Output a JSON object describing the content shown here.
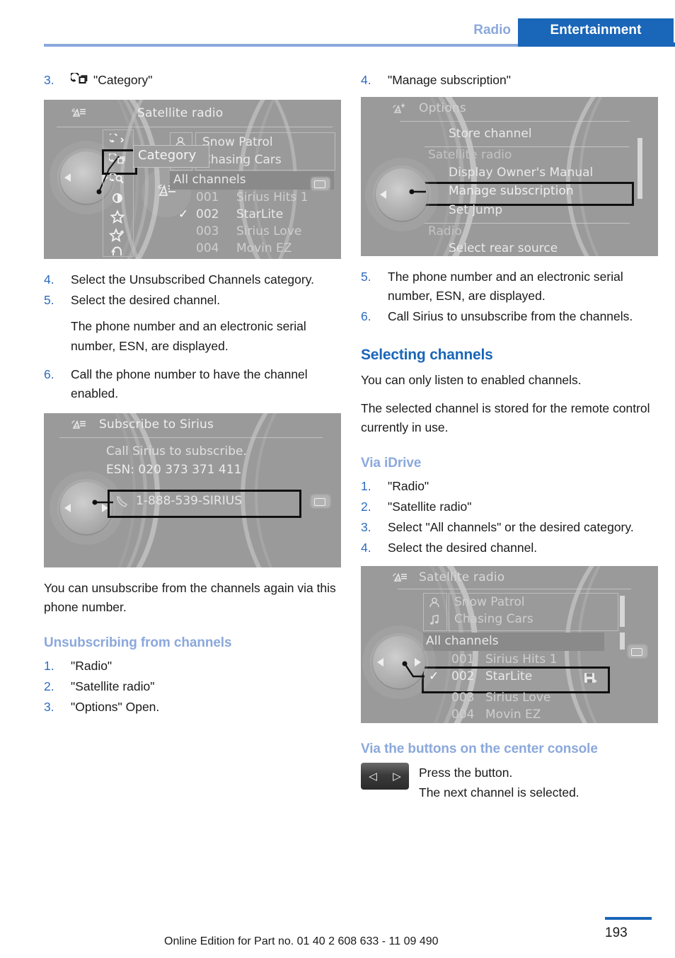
{
  "header": {
    "section": "Radio",
    "tab": "Entertainment",
    "accent_dark": "#1a66b8",
    "accent_light": "#8ba8dc"
  },
  "left_column": {
    "step3": {
      "num": "3.",
      "icon": "category-icon",
      "text": "\"Category\""
    },
    "shot1": {
      "name": "satellite-radio-category-screen",
      "title": "Satellite radio",
      "tooltip": "Category",
      "artist": "Snow Patrol",
      "track": "Chasing Cars",
      "band": "All channels",
      "channels": [
        {
          "check": "",
          "num": "001",
          "name": "Sirius Hits 1"
        },
        {
          "check": "✓",
          "num": "002",
          "name": "StarLite"
        },
        {
          "check": "",
          "num": "003",
          "name": "Sirius Love"
        },
        {
          "check": "",
          "num": "004",
          "name": "Movin EZ"
        }
      ]
    },
    "steps": [
      {
        "num": "4.",
        "text": "Select the Unsubscribed Channels category."
      },
      {
        "num": "5.",
        "text": "Select the desired channel."
      }
    ],
    "note1": "The phone number and an electronic serial number, ESN, are displayed.",
    "step6": {
      "num": "6.",
      "text": "Call the phone number to have the channel enabled."
    },
    "shot2": {
      "name": "subscribe-to-sirius-screen",
      "title": "Subscribe to Sirius",
      "line1": "Call Sirius to subscribe.",
      "line2": "ESN: 020 373 371 411",
      "phone": "1-888-539-SIRIUS"
    },
    "note2": "You can unsubscribe from the channels again via this phone number.",
    "subhead": "Unsubscribing from channels",
    "unsub_steps": [
      {
        "num": "1.",
        "text": "\"Radio\""
      },
      {
        "num": "2.",
        "text": "\"Satellite radio\""
      },
      {
        "num": "3.",
        "text": "\"Options\" Open."
      }
    ]
  },
  "right_column": {
    "step4": {
      "num": "4.",
      "text": "\"Manage subscription\""
    },
    "shot3": {
      "name": "options-menu-screen",
      "title": "Options",
      "items": [
        {
          "label": "Store channel",
          "group": false,
          "highlight": false
        },
        {
          "label": "Satellite radio",
          "group": true,
          "highlight": false
        },
        {
          "label": "Display Owner's Manual",
          "group": false,
          "highlight": false
        },
        {
          "label": "Manage subscription",
          "group": false,
          "highlight": true
        },
        {
          "label": "Set jump",
          "group": false,
          "highlight": false
        },
        {
          "label": "Radio",
          "group": true,
          "highlight": false
        },
        {
          "label": "Select rear source",
          "group": false,
          "highlight": false
        }
      ]
    },
    "steps": [
      {
        "num": "5.",
        "text": "The phone number and an electronic serial number, ESN, are displayed."
      },
      {
        "num": "6.",
        "text": "Call Sirius to unsubscribe from the channels."
      }
    ],
    "section_head": "Selecting channels",
    "para1": "You can only listen to enabled channels.",
    "para2": "The selected channel is stored for the remote control currently in use.",
    "subhead_idrive": "Via iDrive",
    "idrive_steps": [
      {
        "num": "1.",
        "text": "\"Radio\""
      },
      {
        "num": "2.",
        "text": "\"Satellite radio\""
      },
      {
        "num": "3.",
        "text": "Select \"All channels\" or the desired category."
      },
      {
        "num": "4.",
        "text": "Select the desired channel."
      }
    ],
    "shot4": {
      "name": "satellite-radio-selecting-screen",
      "title": "Satellite radio",
      "artist": "Snow Patrol",
      "track": "Chasing Cars",
      "band": "All channels",
      "channels": [
        {
          "check": "",
          "num": "001",
          "name": "Sirius Hits 1"
        },
        {
          "check": "✓",
          "num": "002",
          "name": "StarLite"
        },
        {
          "check": "",
          "num": "003",
          "name": "Sirius Love"
        },
        {
          "check": "",
          "num": "004",
          "name": "Movin EZ"
        }
      ]
    },
    "subhead_console": "Via the buttons on the center console",
    "console_button": {
      "left": "◁",
      "right": "▷"
    },
    "console_line1": "Press the button.",
    "console_line2": "The next channel is selected."
  },
  "footer": {
    "edition": "Online Edition for Part no. 01 40 2 608 633 - 11 09 490",
    "page": "193"
  }
}
